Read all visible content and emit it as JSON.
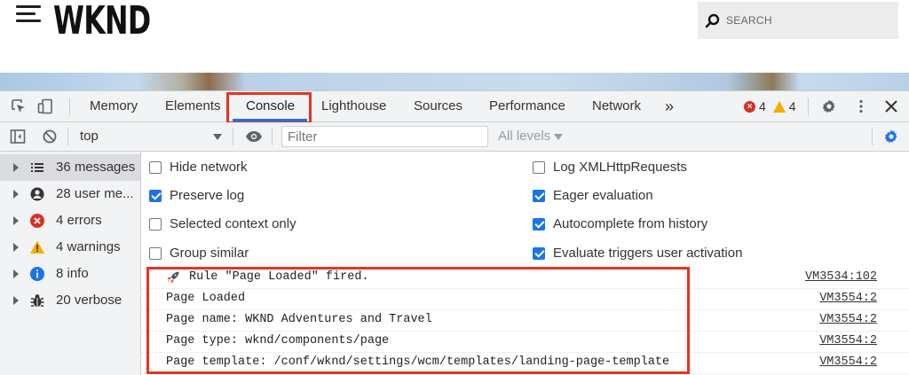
{
  "site": {
    "logo": "WKND",
    "search_placeholder": "SEARCH"
  },
  "devtools": {
    "tabs": [
      "Memory",
      "Elements",
      "Console",
      "Lighthouse",
      "Sources",
      "Performance",
      "Network"
    ],
    "active_tab": "Console",
    "more_tabs": "»",
    "error_count": "4",
    "warning_count": "4",
    "context": "top",
    "filter_placeholder": "Filter",
    "levels": "All levels",
    "sidebar": [
      {
        "label": "36 messages",
        "icon": "list-icon"
      },
      {
        "label": "28 user me...",
        "icon": "user-icon"
      },
      {
        "label": "4 errors",
        "icon": "error-icon"
      },
      {
        "label": "4 warnings",
        "icon": "warning-icon"
      },
      {
        "label": "8 info",
        "icon": "info-icon"
      },
      {
        "label": "20 verbose",
        "icon": "bug-icon"
      }
    ],
    "settings_left": [
      {
        "label": "Hide network",
        "checked": false
      },
      {
        "label": "Preserve log",
        "checked": true
      },
      {
        "label": "Selected context only",
        "checked": false
      },
      {
        "label": "Group similar",
        "checked": false
      }
    ],
    "settings_right": [
      {
        "label": "Log XMLHttpRequests",
        "checked": false
      },
      {
        "label": "Eager evaluation",
        "checked": true
      },
      {
        "label": "Autocomplete from history",
        "checked": true
      },
      {
        "label": "Evaluate triggers user activation",
        "checked": true
      }
    ],
    "log": [
      {
        "message": "Rule \"Page Loaded\" fired.",
        "source": "VM3534:102"
      },
      {
        "message": "Page Loaded",
        "source": "VM3554:2"
      },
      {
        "message": "Page name: WKND Adventures and Travel",
        "source": "VM3554:2"
      },
      {
        "message": "Page type: wknd/components/page",
        "source": "VM3554:2"
      },
      {
        "message": "Page template: /conf/wknd/settings/wcm/templates/landing-page-template",
        "source": "VM3554:2"
      }
    ]
  },
  "colors": {
    "accent": "#1a73e8",
    "highlight_box": "#e8331f",
    "error": "#d93025",
    "warning": "#f9ab00"
  }
}
